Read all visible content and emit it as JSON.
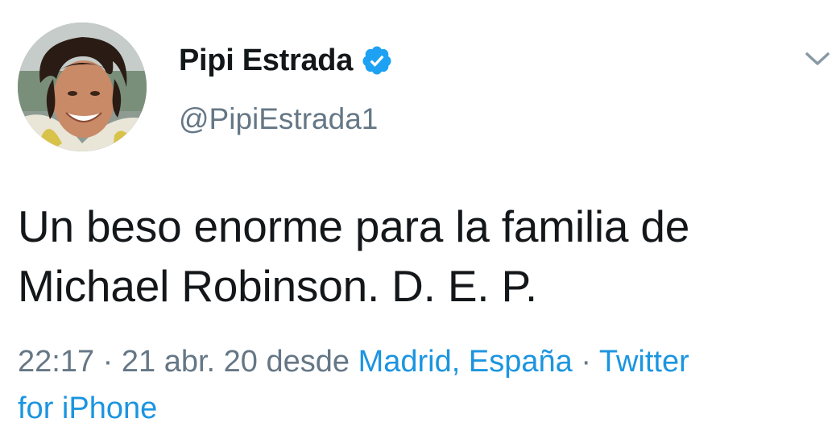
{
  "tweet": {
    "display_name": "Pipi Estrada",
    "handle": "@PipiEstrada1",
    "text_line1": "Un beso enorme para la familia de",
    "text_line2": "Michael Robinson. D. E. P.",
    "time": "22:17",
    "separator": "·",
    "date": "21 abr. 20",
    "desde": "desde",
    "location": "Madrid, España",
    "source_line1": "Twitter",
    "source_line2": "for iPhone"
  },
  "icons": {
    "verified": "verified-badge-icon",
    "caret": "chevron-down-icon",
    "avatar": "profile-photo"
  },
  "colors": {
    "text": "#14171a",
    "muted": "#657786",
    "link": "#1b95e0",
    "verified": "#1da1f2"
  }
}
